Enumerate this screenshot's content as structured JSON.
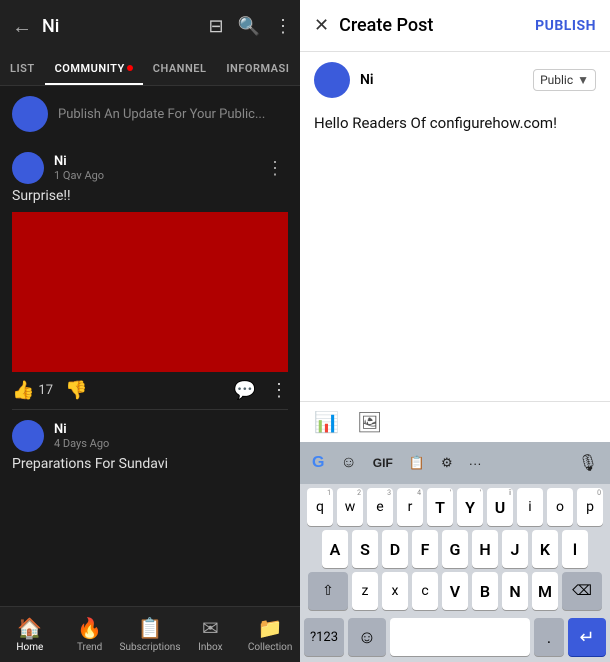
{
  "left": {
    "title": "Ni",
    "back_icon": "←",
    "cast_icon": "⊡",
    "search_icon": "🔍",
    "more_icon": "⋮",
    "tabs": [
      {
        "label": "LIST",
        "active": false
      },
      {
        "label": "COMMUNITY",
        "active": true,
        "dot": true
      },
      {
        "label": "CHANNEL",
        "active": false
      },
      {
        "label": "INFORMASI",
        "active": false
      }
    ],
    "publish_placeholder": "Publish An Update For Your Public...",
    "post1": {
      "author": "Ni",
      "time": "1 Qav Ago",
      "content": "Surprise!!",
      "likes": "17",
      "menu_icon": "⋮"
    },
    "post2": {
      "author": "Ni",
      "time": "4 Days Ago",
      "content": "Preparations For Sundavi"
    },
    "bottom_nav": [
      {
        "icon": "🏠",
        "label": "Home",
        "active": true
      },
      {
        "icon": "🔥",
        "label": "Trend"
      },
      {
        "icon": "📋",
        "label": "Subscriptions"
      },
      {
        "icon": "✉",
        "label": "Inbox"
      },
      {
        "icon": "📁",
        "label": "Collection"
      }
    ]
  },
  "right": {
    "close_icon": "✕",
    "title": "Create Post",
    "publish_label": "PUBLISH",
    "username": "Ni",
    "audience": "Public",
    "post_text": "Hello Readers Of configurehow.com!",
    "toolbar": {
      "chart_icon": "📊",
      "image_icon": "🖼"
    },
    "keyboard": {
      "toolbar_buttons": [
        "G",
        "☺",
        "GIF",
        "📋",
        "⚙",
        "···",
        "🎙"
      ],
      "row1": [
        {
          "key": "q",
          "num": "1"
        },
        {
          "key": "w",
          "num": "2"
        },
        {
          "key": "e",
          "num": "3"
        },
        {
          "key": "r",
          "num": "4"
        },
        {
          "key": "T",
          "num": ""
        },
        {
          "key": "Y",
          "num": ""
        },
        {
          "key": "U",
          "num": ""
        },
        {
          "key": "i",
          "num": ""
        },
        {
          "key": "o",
          "num": ""
        },
        {
          "key": "p",
          "num": "0"
        }
      ],
      "row2": [
        {
          "key": "A"
        },
        {
          "key": "S"
        },
        {
          "key": "D"
        },
        {
          "key": "F"
        },
        {
          "key": "G"
        },
        {
          "key": "H"
        },
        {
          "key": "J"
        },
        {
          "key": "K"
        },
        {
          "key": "l"
        }
      ],
      "row3_shift": "⇧",
      "row3": [
        {
          "key": "z"
        },
        {
          "key": "x"
        },
        {
          "key": "c"
        },
        {
          "key": "v",
          "cap": true
        },
        {
          "key": "B"
        },
        {
          "key": "N"
        },
        {
          "key": "m",
          "cap": true
        }
      ],
      "row3_backspace": "⌫",
      "bottom": {
        "num_switch": "?123",
        "comma": ",",
        "emoji": "☺",
        "space_label": "",
        "period": ".",
        "enter_icon": "↵"
      }
    }
  }
}
